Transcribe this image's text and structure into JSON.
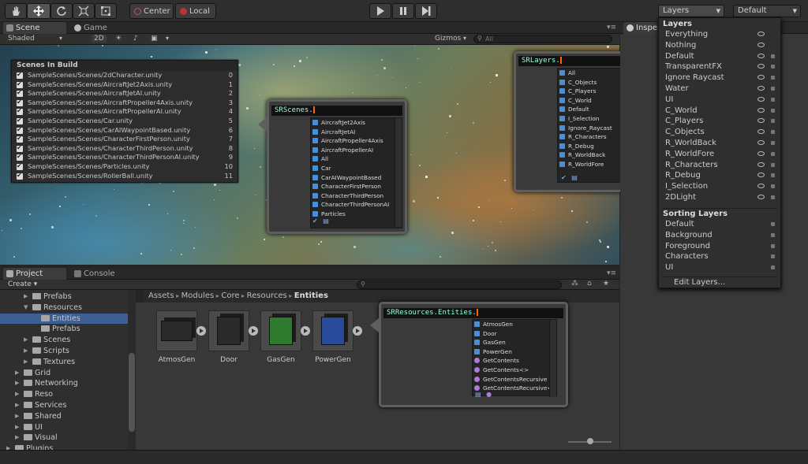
{
  "toolbar": {
    "pivot_center": "Center",
    "pivot_local": "Local",
    "layers_dropdown": "Layers",
    "layout_dropdown": "Default"
  },
  "scene_tabs": {
    "scene": "Scene",
    "game": "Game",
    "inspector": "Inspe"
  },
  "scene_bar": {
    "shading": "Shaded",
    "mode_2d": "2D",
    "gizmos": "Gizmos",
    "search_placeholder": "All"
  },
  "build_panel": {
    "title": "Scenes In Build",
    "rows": [
      {
        "path": "SampleScenes/Scenes/2dCharacter.unity",
        "index": "0"
      },
      {
        "path": "SampleScenes/Scenes/AircraftJet2Axis.unity",
        "index": "1"
      },
      {
        "path": "SampleScenes/Scenes/AircraftJetAI.unity",
        "index": "2"
      },
      {
        "path": "SampleScenes/Scenes/AircraftPropeller4Axis.unity",
        "index": "3"
      },
      {
        "path": "SampleScenes/Scenes/AircraftPropellerAI.unity",
        "index": "4"
      },
      {
        "path": "SampleScenes/Scenes/Car.unity",
        "index": "5"
      },
      {
        "path": "SampleScenes/Scenes/CarAIWaypointBased.unity",
        "index": "6"
      },
      {
        "path": "SampleScenes/Scenes/CharacterFirstPerson.unity",
        "index": "7"
      },
      {
        "path": "SampleScenes/Scenes/CharacterThirdPerson.unity",
        "index": "8"
      },
      {
        "path": "SampleScenes/Scenes/CharacterThirdPersonAI.unity",
        "index": "9"
      },
      {
        "path": "SampleScenes/Scenes/Particles.unity",
        "index": "10"
      },
      {
        "path": "SampleScenes/Scenes/RollerBall.unity",
        "index": "11"
      }
    ]
  },
  "srscenes_popup": {
    "input": "SRScenes.",
    "items": [
      "AircraftJet2Axis",
      "AircraftJetAI",
      "AircraftPropeller4Axis",
      "AircraftPropellerAI",
      "All",
      "Car",
      "CarAIWaypointBased",
      "CharacterFirstPerson",
      "CharacterThirdPerson",
      "CharacterThirdPersonAI",
      "Particles"
    ]
  },
  "srlayers_popup": {
    "input": "SRLayers.",
    "items": [
      "All",
      "C_Objects",
      "C_Players",
      "C_World",
      "Default",
      "I_Selection",
      "Ignore_Raycast",
      "R_Characters",
      "R_Debug",
      "R_WorldBack",
      "R_WorldFore"
    ]
  },
  "srresources_popup": {
    "input": "SRResources.Entities.",
    "items": [
      {
        "label": "AtmosGen",
        "kind": "class"
      },
      {
        "label": "Door",
        "kind": "class"
      },
      {
        "label": "GasGen",
        "kind": "class"
      },
      {
        "label": "PowerGen",
        "kind": "class"
      },
      {
        "label": "GetContents",
        "kind": "method"
      },
      {
        "label": "GetContents<>",
        "kind": "method"
      },
      {
        "label": "GetContentsRecursive",
        "kind": "method"
      },
      {
        "label": "GetContentsRecursive<>",
        "kind": "method"
      }
    ]
  },
  "layers_menu": {
    "layers_heading": "Layers",
    "layers": [
      "Everything",
      "Nothing",
      "Default",
      "TransparentFX",
      "Ignore Raycast",
      "Water",
      "UI",
      "C_World",
      "C_Players",
      "C_Objects",
      "R_WorldBack",
      "R_WorldFore",
      "R_Characters",
      "R_Debug",
      "I_Selection",
      "2DLight"
    ],
    "sorting_heading": "Sorting Layers",
    "sorting_layers": [
      "Default",
      "Background",
      "Foreground",
      "Characters",
      "UI"
    ],
    "edit": "Edit Layers..."
  },
  "project_tabs": {
    "project": "Project",
    "console": "Console",
    "create": "Create"
  },
  "project_tree": [
    {
      "label": "Prefabs",
      "depth": 3,
      "expanded": false
    },
    {
      "label": "Resources",
      "depth": 3,
      "expanded": true
    },
    {
      "label": "Entities",
      "depth": 4,
      "expanded": false,
      "selected": true
    },
    {
      "label": "Prefabs",
      "depth": 4,
      "expanded": false
    },
    {
      "label": "Scenes",
      "depth": 3,
      "expanded": false
    },
    {
      "label": "Scripts",
      "depth": 3,
      "expanded": false
    },
    {
      "label": "Textures",
      "depth": 3,
      "expanded": false
    },
    {
      "label": "Grid",
      "depth": 2,
      "expanded": false
    },
    {
      "label": "Networking",
      "depth": 2,
      "expanded": false
    },
    {
      "label": "Reso",
      "depth": 2,
      "expanded": false
    },
    {
      "label": "Services",
      "depth": 2,
      "expanded": false
    },
    {
      "label": "Shared",
      "depth": 2,
      "expanded": false
    },
    {
      "label": "UI",
      "depth": 2,
      "expanded": false
    },
    {
      "label": "Visual",
      "depth": 2,
      "expanded": false
    },
    {
      "label": "Plugins",
      "depth": 1,
      "expanded": false
    }
  ],
  "breadcrumb": [
    "Assets",
    "Modules",
    "Core",
    "Resources",
    "Entities"
  ],
  "assets": [
    {
      "label": "AtmosGen",
      "color": "#2a2a2a"
    },
    {
      "label": "Door",
      "color": "#2a2a2a"
    },
    {
      "label": "GasGen",
      "color": "#2f7a2f"
    },
    {
      "label": "PowerGen",
      "color": "#2a4a9a"
    }
  ]
}
